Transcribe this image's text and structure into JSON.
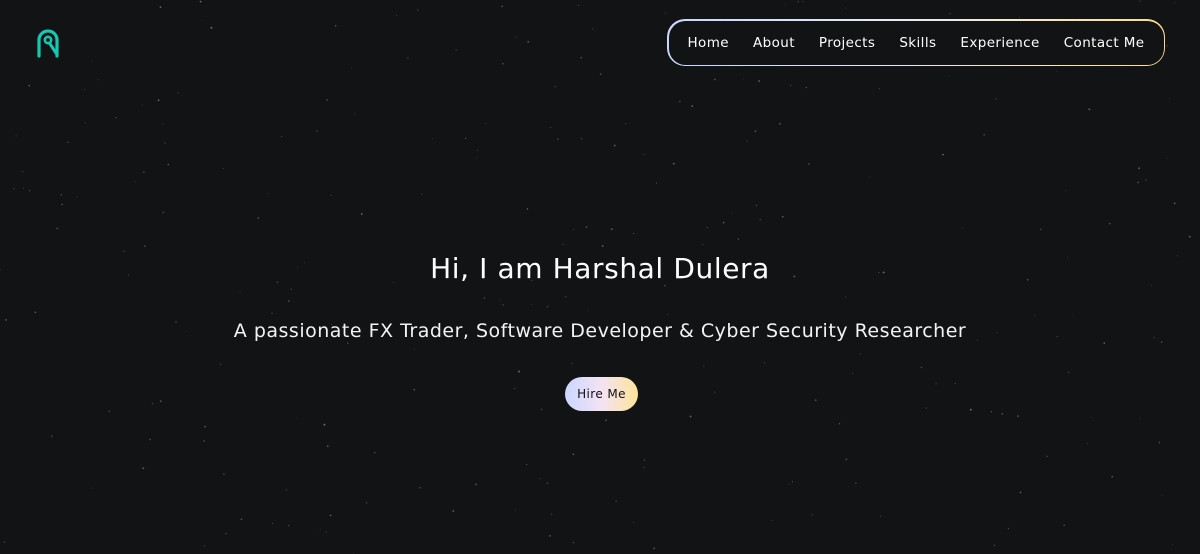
{
  "brand": {
    "logo_icon": "brand-logo-icon",
    "logo_color": "#14c9b4"
  },
  "nav": {
    "items": [
      {
        "label": "Home"
      },
      {
        "label": "About"
      },
      {
        "label": "Projects"
      },
      {
        "label": "Skills"
      },
      {
        "label": "Experience"
      },
      {
        "label": "Contact Me"
      }
    ],
    "border_gradient": [
      "#c9d6ff",
      "#ffd98e"
    ]
  },
  "hero": {
    "title": "Hi, I am Harshal Dulera",
    "subtitle": "A passionate FX Trader, Software Developer & Cyber Security Researcher",
    "cta_label": "Hire Me"
  },
  "colors": {
    "background": "#121314",
    "text": "#ffffff",
    "star": "#8a8d93"
  }
}
